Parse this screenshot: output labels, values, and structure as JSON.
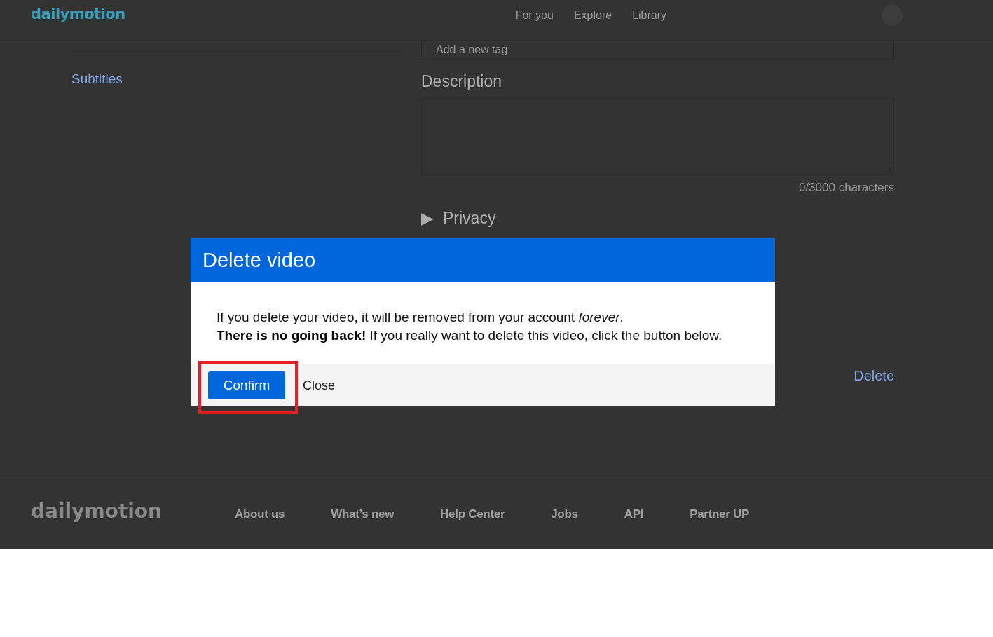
{
  "header": {
    "logo": "dailymotion",
    "nav": [
      {
        "label": "For you"
      },
      {
        "label": "Explore"
      },
      {
        "label": "Library"
      }
    ]
  },
  "sidebar": {
    "items": [
      {
        "label": "Subtitles"
      }
    ]
  },
  "form": {
    "tag_field": {
      "placeholder": "Add a new tag"
    },
    "description": {
      "label": "Description",
      "counter": "0/3000 characters"
    },
    "privacy": {
      "label": "Privacy",
      "expanded": false,
      "arrow": "▶"
    },
    "delete_link": "Delete"
  },
  "dialog": {
    "title": "Delete video",
    "message": [
      "If you delete your video, it will be removed from your account *forever*.",
      "**There is no going back!** If you really want to delete this video, click the button below."
    ],
    "buttons": [
      {
        "label": "Confirm",
        "kind": "primary",
        "highlighted": true
      },
      {
        "label": "Close",
        "kind": "plain",
        "highlighted": false
      }
    ]
  },
  "footer": {
    "logo": "dailymotion",
    "links": [
      {
        "label": "About us"
      },
      {
        "label": "What’s new"
      },
      {
        "label": "Help Center"
      },
      {
        "label": "Jobs"
      },
      {
        "label": "API"
      },
      {
        "label": "Partner UP"
      }
    ]
  }
}
